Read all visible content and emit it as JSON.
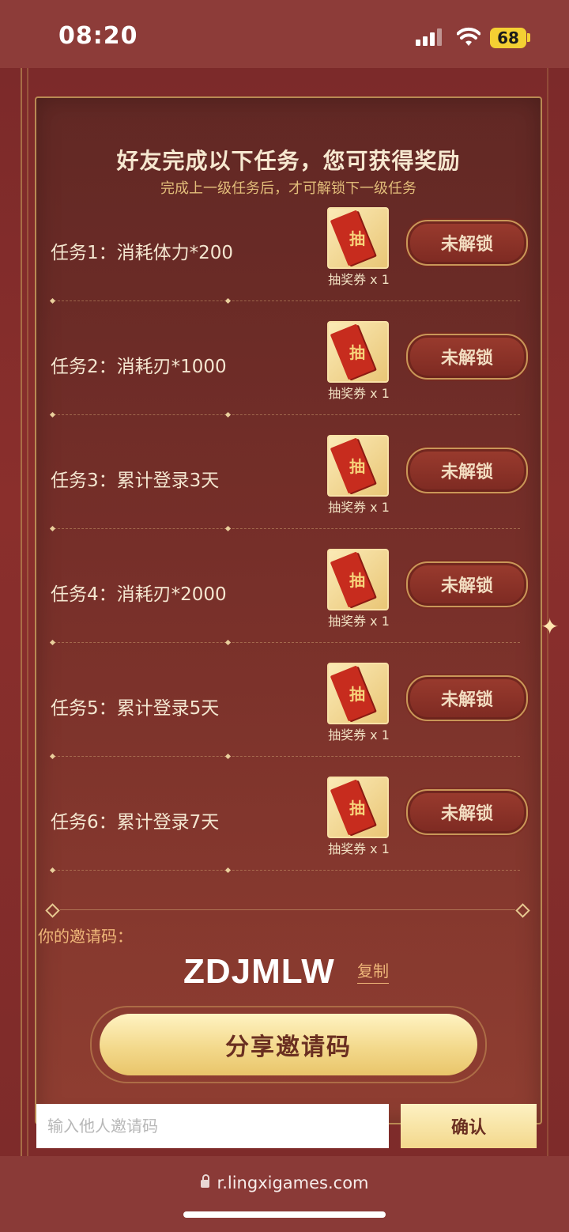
{
  "status_bar": {
    "time": "08:20",
    "battery": "68"
  },
  "panel": {
    "title": "好友完成以下任务，您可获得奖励",
    "subtitle": "完成上一级任务后，才可解锁下一级任务",
    "ticket_char": "抽",
    "tasks": [
      {
        "label": "任务1：消耗体力*200",
        "reward": "抽奖券 x 1",
        "status": "未解锁"
      },
      {
        "label": "任务2：消耗刃*1000",
        "reward": "抽奖券 x 1",
        "status": "未解锁"
      },
      {
        "label": "任务3：累计登录3天",
        "reward": "抽奖券 x 1",
        "status": "未解锁"
      },
      {
        "label": "任务4：消耗刃*2000",
        "reward": "抽奖券 x 1",
        "status": "未解锁"
      },
      {
        "label": "任务5：累计登录5天",
        "reward": "抽奖券 x 1",
        "status": "未解锁"
      },
      {
        "label": "任务6：累计登录7天",
        "reward": "抽奖券 x 1",
        "status": "未解锁"
      }
    ]
  },
  "invite": {
    "label": "你的邀请码：",
    "code": "ZDJMLW",
    "copy_label": "复制",
    "share_label": "分享邀请码",
    "input_placeholder": "输入他人邀请码",
    "confirm_label": "确认"
  },
  "browser": {
    "url": "r.lingxigames.com"
  }
}
